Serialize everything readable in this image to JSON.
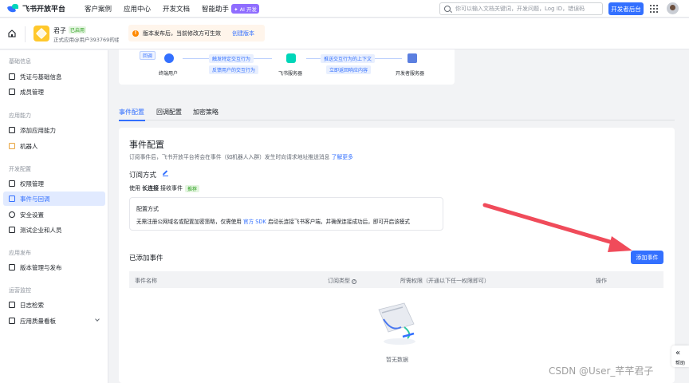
{
  "topbar": {
    "logo_text": "飞书开放平台",
    "nav": [
      "客户案例",
      "应用中心",
      "开发文档",
      "智能助手"
    ],
    "ai_badge": "✦ AI 开发",
    "search_placeholder": "你可以输入文档关键词，开发问题，Log ID，错误码",
    "console_button": "开发者后台"
  },
  "app": {
    "name": "君子",
    "status": "已启用",
    "desc": "正式应用@用户393769的组织"
  },
  "notice": {
    "text": "版本发布后，当前修改方可生效",
    "link": "创建版本"
  },
  "sidebar": {
    "groups": [
      {
        "title": "基础信息",
        "items": [
          "凭证与基础信息",
          "成员管理"
        ]
      },
      {
        "title": "应用能力",
        "items": [
          "添加应用能力",
          "机器人"
        ]
      },
      {
        "title": "开发配置",
        "items": [
          "权限管理",
          "事件与回调",
          "安全设置",
          "测试企业和人员"
        ]
      },
      {
        "title": "应用发布",
        "items": [
          "版本管理与发布"
        ]
      },
      {
        "title": "运营监控",
        "items": [
          "日志检索",
          "应用质量看板"
        ]
      }
    ],
    "active_item": "事件与回调"
  },
  "flow": {
    "tag": "回调",
    "nodes": [
      "终端用户",
      "飞书服务器",
      "开发者服务器"
    ],
    "arrows": [
      "触发特定交互行为",
      "反馈用户的交互行为",
      "推送交互行为的上下文",
      "立即返回响应内容"
    ]
  },
  "tabs": [
    "事件配置",
    "回调配置",
    "加密策略"
  ],
  "event_config": {
    "title": "事件配置",
    "desc": "订阅事件后，飞书开放平台将会在事件（如机器人入群）发生时向请求地址推送消息",
    "desc_link": "了解更多",
    "subscribe_title": "订阅方式",
    "mode_prefix": "使用",
    "mode_bold": "长连接",
    "mode_suffix": "接收事件",
    "mode_badge": "推荐",
    "config_title": "配置方式",
    "config_text_1": "无需注册公网域名或配置加密策略，仅需使用",
    "config_link": "官方 SDK",
    "config_text_2": "启动长连接飞书客户端，并确保连接成功后，即可开启该模式",
    "added_title": "已添加事件",
    "add_button": "添加事件",
    "table_headers": [
      "事件名称",
      "订阅类型",
      "所需权限（开通以下任一权限即可）",
      "操作"
    ],
    "q_mark": "?",
    "empty_text": "暂无数据"
  },
  "side_tab": {
    "chevron": "«",
    "label": "帮助"
  },
  "watermark": "CSDN @User_芊芊君子",
  "colors": {
    "primary": "#3370ff",
    "success": "#2ea121",
    "warning": "#ff8800",
    "annotation_arrow": "#f04b5a"
  }
}
